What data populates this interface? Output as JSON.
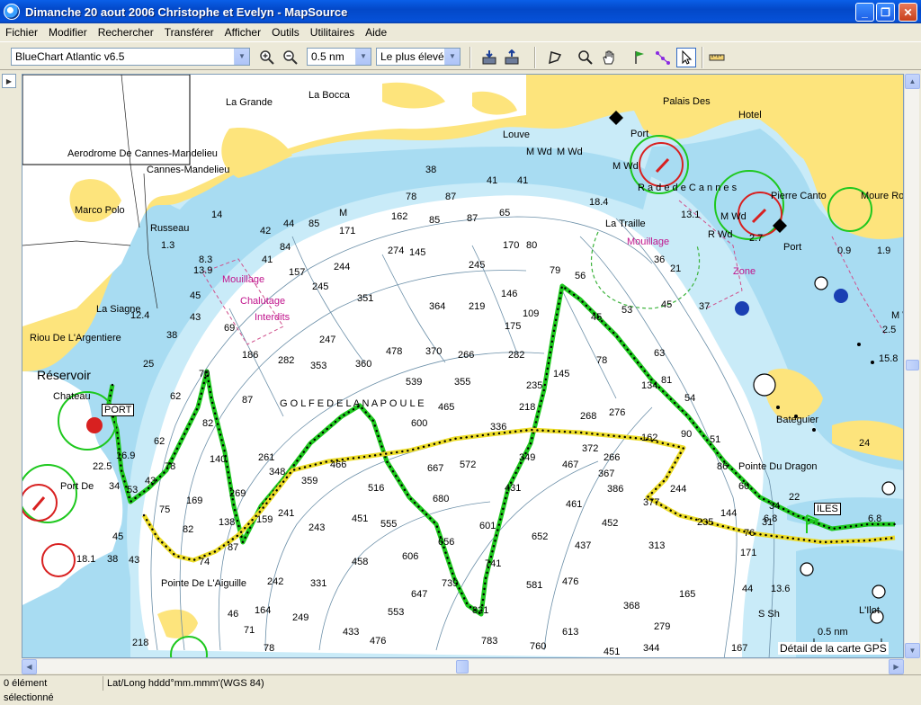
{
  "window": {
    "title": "Dimanche 20 aout 2006 Christophe et Evelyn - MapSource"
  },
  "menu": [
    "Fichier",
    "Modifier",
    "Rechercher",
    "Transférer",
    "Afficher",
    "Outils",
    "Utilitaires",
    "Aide"
  ],
  "toolbar": {
    "product": "BlueChart Atlantic v6.5",
    "zoom": "0.5 nm",
    "detail": "Le plus élevé"
  },
  "map": {
    "places": {
      "la_bocca": "La Bocca",
      "la_grande": "La Grande",
      "aerodrome": "Aerodrome De Cannes-Mandelieu",
      "cannes_mandelieu": "Cannes-Mandelieu",
      "marco_polo": "Marco Polo",
      "russeau": "Russeau",
      "la_siagne": "La Siagne",
      "riou": "Riou De L'Argentiere",
      "reservoir": "Réservoir",
      "chateau": "Chateau",
      "port_de": "Port De",
      "pointe_aiguille": "Pointe De L'Aiguille",
      "louve": "Louve",
      "palais_des": "Palais Des",
      "hotel": "Hotel",
      "port_top": "Port",
      "rade_de_cannes": "R a d e d e C a n n e s",
      "la_traille": "La Traille",
      "pierre_canto": "Pierre Canto",
      "moure_ro": "Moure Ro",
      "port_east": "Port",
      "bateguier": "Bateguier",
      "pointe_du_dragon": "Pointe Du Dragon",
      "golfe": "G O L F E D E L A N A P O U L E",
      "l_ilot": "L'Ilot"
    },
    "annotations": {
      "mouillage_left": "Mouillage",
      "chalutage": "Chalutage",
      "interdits": "Interdits",
      "mouillage_right": "Mouillage",
      "zone": "Zone"
    },
    "waypoint_labels": {
      "port": "PORT",
      "iles": "ILES"
    },
    "scale": "0.5 nm",
    "footer": "Détail de la carte GPS"
  },
  "status": {
    "selection": "0 élément sélectionné",
    "position_format": "Lat/Long hddd°mm.mmm'(WGS 84)"
  },
  "colors": {
    "land": "#fde47c",
    "shallow": "#a8dcf2",
    "mid_water": "#c9ebf8",
    "deep": "#ffffff",
    "track_green": "#1ec81e",
    "track_yellow": "#ecdc28",
    "magenta": "#c0148c"
  }
}
